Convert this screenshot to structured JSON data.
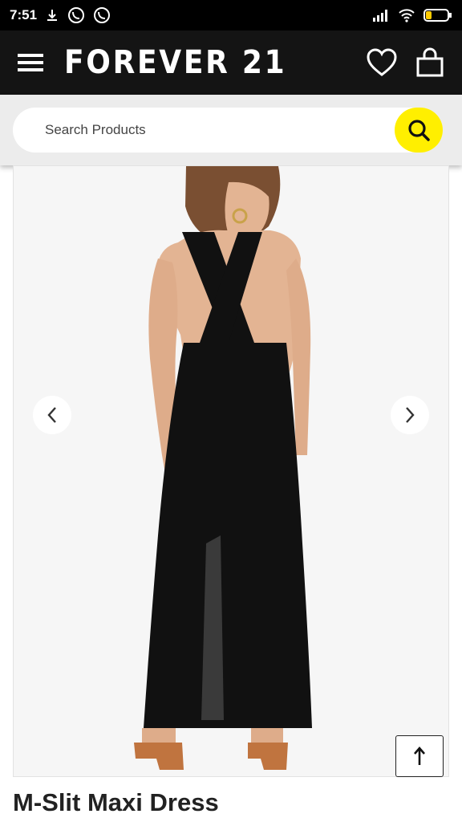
{
  "status_bar": {
    "time": "7:51"
  },
  "header": {
    "brand": "FOREVER 21"
  },
  "search": {
    "placeholder": "Search Products"
  },
  "product": {
    "title": "M-Slit Maxi Dress"
  },
  "colors": {
    "appbar": "#141414",
    "search_accent": "#ffef00",
    "dress": "#111111",
    "skin": "#e3b493",
    "shoes": "#c0743f"
  },
  "icons": [
    "download-icon",
    "viber-icon",
    "signal-icon",
    "wifi-icon",
    "battery-icon",
    "menu-icon",
    "heart-icon",
    "bag-icon",
    "search-icon",
    "chevron-left-icon",
    "chevron-right-icon",
    "arrow-up-icon"
  ]
}
